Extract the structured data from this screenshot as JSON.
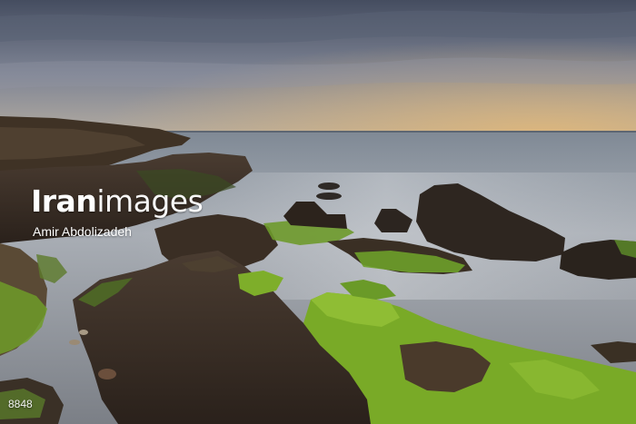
{
  "watermark": {
    "brand_bold": "Iran",
    "brand_light": "images",
    "credit": "Amir Abdolizadeh"
  },
  "image_id": "8848",
  "scene": {
    "subject": "moss-covered-rocks-on-misty-sea-shore",
    "colors": {
      "sky_top": "#4a5265",
      "sky_mid": "#8a8e9c",
      "horizon_glow": "#d9b27a",
      "sea": "#a4aab3",
      "rock": "#3a2e25",
      "moss": "#7fae2a"
    }
  }
}
